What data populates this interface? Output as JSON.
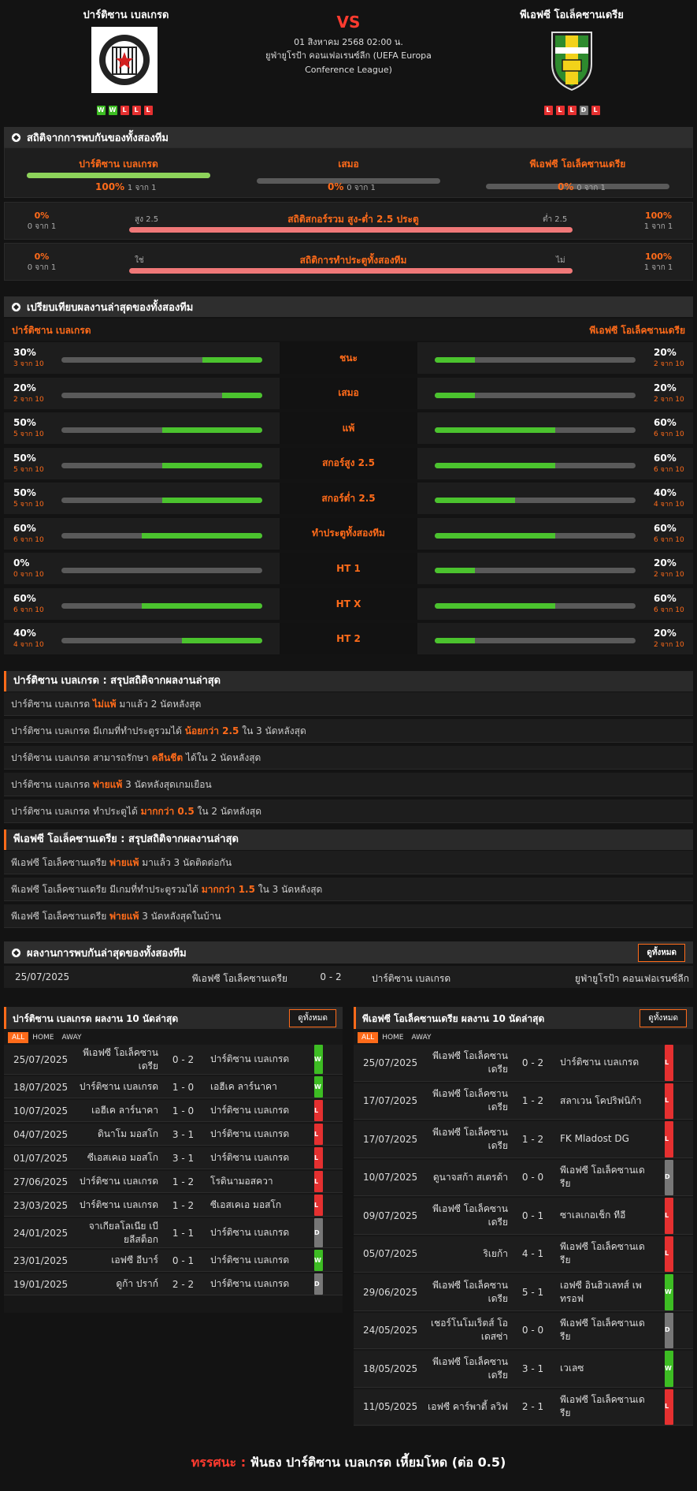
{
  "header": {
    "home_team": "ปาร์ติซาน เบลเกรด",
    "away_team": "พีเอฟซี โอเล็คซานเดรีย",
    "vs": "VS",
    "datetime": "01 สิงหาคม 2568 02:00 น.",
    "competition": "ยูฟ่ายูโรป้า คอนเฟอเรนซ์ลีก (UEFA Europa Conference League)",
    "home_form": [
      "W",
      "W",
      "L",
      "L",
      "L"
    ],
    "away_form": [
      "L",
      "L",
      "L",
      "D",
      "L"
    ],
    "home_logo_text": "ПАРТИЗАН",
    "away_logo_text": "ОЛЕКСАНДРІЯ"
  },
  "h2h": {
    "title": "สถิติจากการพบกันของทั้งสองทีม",
    "home_label": "ปาร์ติซาน เบลเกรด",
    "home_pct": "100%",
    "home_sub": "1 จาก 1",
    "home_fill": 1.0,
    "draw_label": "เสมอ",
    "draw_pct": "0%",
    "draw_sub": "0 จาก 1",
    "draw_fill": 0,
    "away_label": "พีเอฟซี โอเล็คซานเดรีย",
    "away_pct": "0%",
    "away_sub": "0 จาก 1",
    "away_fill": 0,
    "ou": {
      "left_pct": "0%",
      "left_sub": "0 จาก 1",
      "left_label": "สูง 2.5",
      "title": "สถิติสกอร์รวม สูง-ต่ำ 2.5 ประตู",
      "right_label": "ต่ำ 2.5",
      "right_pct": "100%",
      "right_sub": "1 จาก 1"
    },
    "btts": {
      "left_pct": "0%",
      "left_sub": "0 จาก 1",
      "left_label": "ใช่",
      "title": "สถิติการทำประตูทั้งสองทีม",
      "right_label": "ไม่",
      "right_pct": "100%",
      "right_sub": "1 จาก 1"
    }
  },
  "compare": {
    "title": "เปรียบเทียบผลงานล่าสุดของทั้งสองทีม",
    "home_team": "ปาร์ติซาน เบลเกรด",
    "away_team": "พีเอฟซี โอเล็คซานเดรีย",
    "rows": [
      {
        "label": "ชนะ",
        "hp": "30%",
        "hs": "3 จาก 10",
        "hf": 0.3,
        "ap": "20%",
        "as": "2 จาก 10",
        "af": 0.2
      },
      {
        "label": "เสมอ",
        "hp": "20%",
        "hs": "2 จาก 10",
        "hf": 0.2,
        "ap": "20%",
        "as": "2 จาก 10",
        "af": 0.2
      },
      {
        "label": "แพ้",
        "hp": "50%",
        "hs": "5 จาก 10",
        "hf": 0.5,
        "ap": "60%",
        "as": "6 จาก 10",
        "af": 0.6
      },
      {
        "label": "สกอร์สูง 2.5",
        "hp": "50%",
        "hs": "5 จาก 10",
        "hf": 0.5,
        "ap": "60%",
        "as": "6 จาก 10",
        "af": 0.6
      },
      {
        "label": "สกอร์ต่ำ 2.5",
        "hp": "50%",
        "hs": "5 จาก 10",
        "hf": 0.5,
        "ap": "40%",
        "as": "4 จาก 10",
        "af": 0.4
      },
      {
        "label": "ทำประตูทั้งสองทีม",
        "hp": "60%",
        "hs": "6 จาก 10",
        "hf": 0.6,
        "ap": "60%",
        "as": "6 จาก 10",
        "af": 0.6
      },
      {
        "label": "HT 1",
        "hp": "0%",
        "hs": "0 จาก 10",
        "hf": 0,
        "ap": "20%",
        "as": "2 จาก 10",
        "af": 0.2
      },
      {
        "label": "HT X",
        "hp": "60%",
        "hs": "6 จาก 10",
        "hf": 0.6,
        "ap": "60%",
        "as": "6 จาก 10",
        "af": 0.6
      },
      {
        "label": "HT 2",
        "hp": "40%",
        "hs": "4 จาก 10",
        "hf": 0.4,
        "ap": "20%",
        "as": "2 จาก 10",
        "af": 0.2
      }
    ]
  },
  "home_summary": {
    "title": "ปาร์ติซาน เบลเกรด : สรุปสถิติจากผลงานล่าสุด",
    "rows": [
      [
        "ปาร์ติซาน เบลเกรด ",
        "ไม่แพ้",
        " มาแล้ว 2 นัดหลังสุด"
      ],
      [
        "ปาร์ติซาน เบลเกรด มีเกมที่ทำประตูรวมได้ ",
        "น้อยกว่า 2.5",
        " ใน 3 นัดหลังสุด"
      ],
      [
        "ปาร์ติซาน เบลเกรด สามารถรักษา ",
        "คลีนชีต",
        " ได้ใน 2 นัดหลังสุด"
      ],
      [
        "ปาร์ติซาน เบลเกรด ",
        "พ่ายแพ้",
        " 3 นัดหลังสุดเกมเยือน"
      ],
      [
        "ปาร์ติซาน เบลเกรด ทำประตูได้ ",
        "มากกว่า 0.5",
        " ใน 2 นัดหลังสุด"
      ]
    ]
  },
  "away_summary": {
    "title": "พีเอฟซี โอเล็คซานเดรีย : สรุปสถิติจากผลงานล่าสุด",
    "rows": [
      [
        "พีเอฟซี โอเล็คซานเดรีย ",
        "พ่ายแพ้",
        " มาแล้ว 3 นัดติดต่อกัน"
      ],
      [
        "พีเอฟซี โอเล็คซานเดรีย มีเกมที่ทำประตูรวมได้ ",
        "มากกว่า 1.5",
        " ใน 3 นัดหลังสุด"
      ],
      [
        "พีเอฟซี โอเล็คซานเดรีย ",
        "พ่ายแพ้",
        " 3 นัดหลังสุดในบ้าน"
      ]
    ]
  },
  "recent_h2h": {
    "title": "ผลงานการพบกันล่าสุดของทั้งสองทีม",
    "button": "ดูทั้งหมด",
    "match": {
      "date": "25/07/2025",
      "home": "พีเอฟซี โอเล็คซานเดรีย",
      "score": "0 - 2",
      "away": "ปาร์ติซาน เบลเกรด",
      "league": "ยูฟ่ายูโรป้า คอนเฟอเรนซ์ลีก"
    }
  },
  "home_last10": {
    "title": "ปาร์ติซาน เบลเกรด ผลงาน 10 นัดล่าสุด",
    "button": "ดูทั้งหมด",
    "tabs": [
      "ALL",
      "HOME",
      "AWAY"
    ],
    "rows": [
      {
        "date": "25/07/2025",
        "home": "พีเอฟซี โอเล็คซานเดรีย",
        "score": "0 - 2",
        "away": "ปาร์ติซาน เบลเกรด",
        "res": "W"
      },
      {
        "date": "18/07/2025",
        "home": "ปาร์ติซาน เบลเกรด",
        "score": "1 - 0",
        "away": "เอฮีเค ลาร์นาคา",
        "res": "W"
      },
      {
        "date": "10/07/2025",
        "home": "เอฮีเค ลาร์นาคา",
        "score": "1 - 0",
        "away": "ปาร์ติซาน เบลเกรด",
        "res": "L"
      },
      {
        "date": "04/07/2025",
        "home": "ดินาโม มอสโก",
        "score": "3 - 1",
        "away": "ปาร์ติซาน เบลเกรด",
        "res": "L"
      },
      {
        "date": "01/07/2025",
        "home": "ซีเอสเคเอ มอสโก",
        "score": "3 - 1",
        "away": "ปาร์ติซาน เบลเกรด",
        "res": "L"
      },
      {
        "date": "27/06/2025",
        "home": "ปาร์ติซาน เบลเกรด",
        "score": "1 - 2",
        "away": "โรดินามอสควา",
        "res": "L"
      },
      {
        "date": "23/03/2025",
        "home": "ปาร์ติซาน เบลเกรด",
        "score": "1 - 2",
        "away": "ซีเอสเคเอ มอสโก",
        "res": "L"
      },
      {
        "date": "24/01/2025",
        "home": "จาเกียลโลเนีย เบียลีสต็อก",
        "score": "1 - 1",
        "away": "ปาร์ติซาน เบลเกรด",
        "res": "D"
      },
      {
        "date": "23/01/2025",
        "home": "เอฟซี อีบาร์",
        "score": "0 - 1",
        "away": "ปาร์ติซาน เบลเกรด",
        "res": "W"
      },
      {
        "date": "19/01/2025",
        "home": "ดูก้า ปราก์",
        "score": "2 - 2",
        "away": "ปาร์ติซาน เบลเกรด",
        "res": "D"
      }
    ]
  },
  "away_last10": {
    "title": "พีเอฟซี โอเล็คซานเดรีย ผลงาน 10 นัดล่าสุด",
    "button": "ดูทั้งหมด",
    "tabs": [
      "ALL",
      "HOME",
      "AWAY"
    ],
    "rows": [
      {
        "date": "25/07/2025",
        "home": "พีเอฟซี โอเล็คซานเดรีย",
        "score": "0 - 2",
        "away": "ปาร์ติซาน เบลเกรด",
        "res": "L"
      },
      {
        "date": "17/07/2025",
        "home": "พีเอฟซี โอเล็คซานเดรีย",
        "score": "1 - 2",
        "away": "สลาเวน โคปริฟนิก้า",
        "res": "L"
      },
      {
        "date": "17/07/2025",
        "home": "พีเอฟซี โอเล็คซานเดรีย",
        "score": "1 - 2",
        "away": "FK Mladost DG",
        "res": "L"
      },
      {
        "date": "10/07/2025",
        "home": "ดูนาจสก้า สเตรด้า",
        "score": "0 - 0",
        "away": "พีเอฟซี โอเล็คซานเดรีย",
        "res": "D"
      },
      {
        "date": "09/07/2025",
        "home": "พีเอฟซี โอเล็คซานเดรีย",
        "score": "0 - 1",
        "away": "ซาเลเกอเช็ก ทีอี",
        "res": "L"
      },
      {
        "date": "05/07/2025",
        "home": "ริเยก้า",
        "score": "4 - 1",
        "away": "พีเอฟซี โอเล็คซานเดรีย",
        "res": "L"
      },
      {
        "date": "29/06/2025",
        "home": "พีเอฟซี โอเล็คซานเดรีย",
        "score": "5 - 1",
        "away": "เอฟซี อินฮิวเลทส์ เพทรอฟ",
        "res": "W"
      },
      {
        "date": "24/05/2025",
        "home": "เชอร์โนโมเร็ตส์ โอเดสซ่า",
        "score": "0 - 0",
        "away": "พีเอฟซี โอเล็คซานเดรีย",
        "res": "D"
      },
      {
        "date": "18/05/2025",
        "home": "พีเอฟซี โอเล็คซานเดรีย",
        "score": "3 - 1",
        "away": "เวเลซ",
        "res": "W"
      },
      {
        "date": "11/05/2025",
        "home": "เอฟซี คาร์พาตี้ ลวิฟ",
        "score": "2 - 1",
        "away": "พีเอฟซี โอเล็คซานเดรีย",
        "res": "L"
      }
    ]
  },
  "prediction": {
    "label": "ทรรศนะ :",
    "text": "ฟันธง ปาร์ติซาน เบลเกรด เหี้ยมโหด (ต่อ 0.5)"
  },
  "colors": {
    "accent": "#ff6b1a",
    "win": "#3dbd23",
    "loss": "#e53030",
    "draw": "#777777",
    "bar_fill": "#4bc32e",
    "ou_bar": "#f07878"
  }
}
